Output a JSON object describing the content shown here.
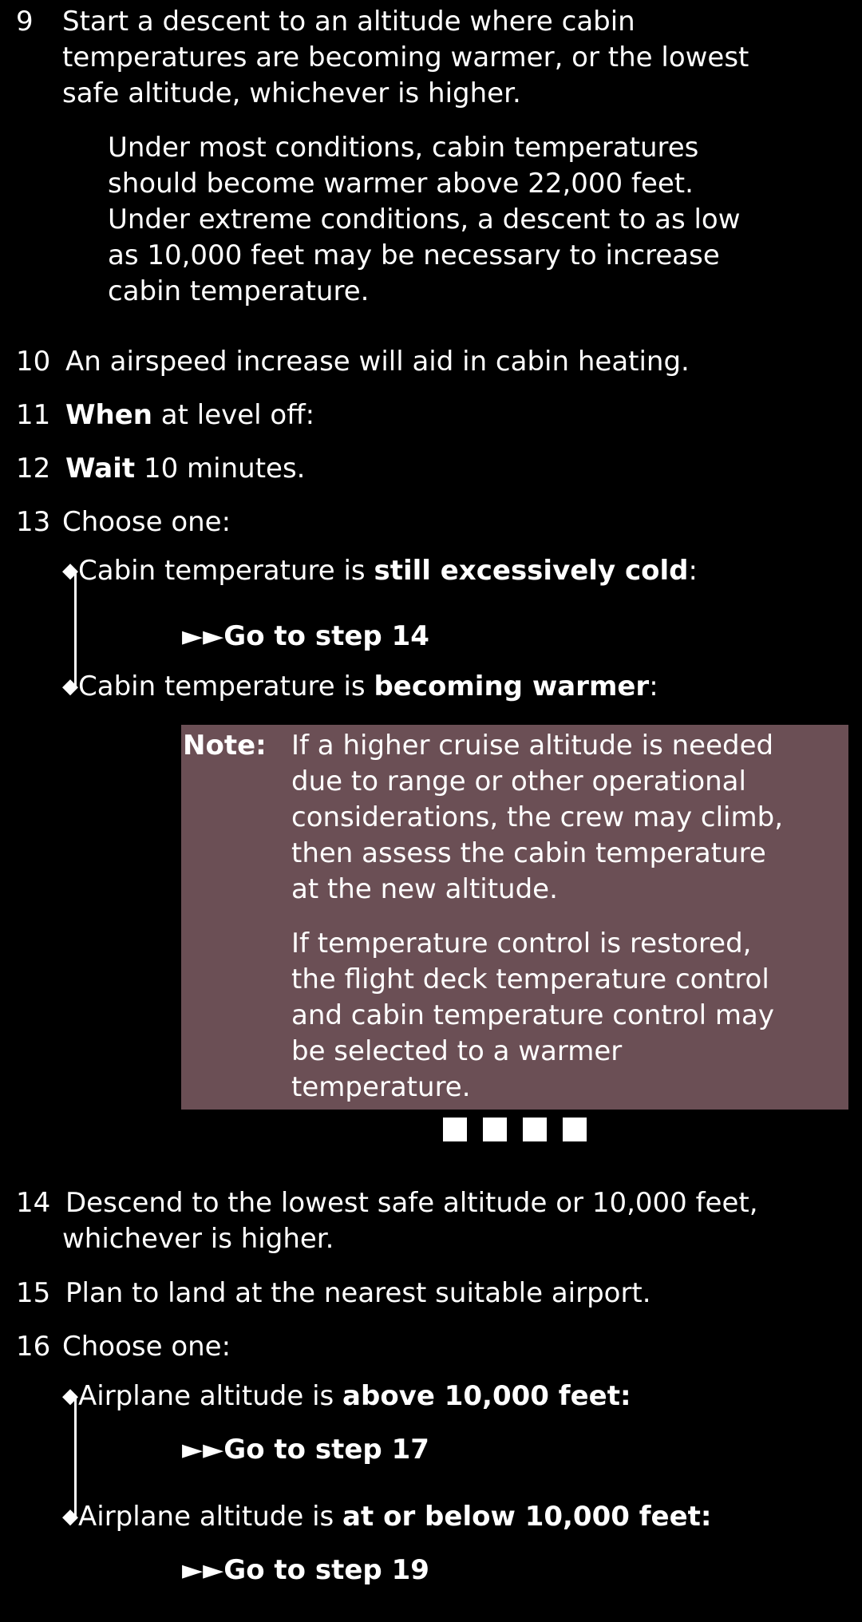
{
  "steps": {
    "s9": {
      "num": "9",
      "line1": "Start a descent to an altitude where cabin",
      "line2": "temperatures are becoming warmer, or the lowest",
      "line3": "safe altitude, whichever is higher.",
      "sub1": "Under most conditions, cabin temperatures",
      "sub2": "should become warmer above 22,000 feet.",
      "sub3": "Under extreme conditions, a descent to as low",
      "sub4": "as 10,000 feet may be necessary to increase",
      "sub5": "cabin temperature."
    },
    "s10": {
      "num": "10",
      "text": "An airspeed increase will aid in cabin heating."
    },
    "s11": {
      "num": "11",
      "bold": "When",
      "rest": " at level off:"
    },
    "s12": {
      "num": "12",
      "bold": "Wait",
      "rest": " 10 minutes."
    },
    "s13": {
      "num": "13",
      "text": "Choose one:",
      "opt1_pre": "Cabin temperature is ",
      "opt1_bold": "still excessively cold",
      "opt1_post": ":",
      "opt1_goto": "Go to step 14",
      "opt2_pre": "Cabin temperature is ",
      "opt2_bold": "becoming warmer",
      "opt2_post": ":",
      "note_label": "Note:",
      "note1_l1": "If a higher cruise altitude is needed",
      "note1_l2": "due to range or other operational",
      "note1_l3": "considerations, the crew may climb,",
      "note1_l4": "then assess the cabin temperature",
      "note1_l5": "at the new altitude.",
      "note2_l1": "If temperature control is restored,",
      "note2_l2": "the flight deck temperature control",
      "note2_l3": "and cabin temperature control may",
      "note2_l4": "be selected to a warmer",
      "note2_l5": "temperature."
    },
    "s14": {
      "num": "14",
      "line1": "Descend to the lowest safe altitude or 10,000 feet,",
      "line2": "whichever is higher."
    },
    "s15": {
      "num": "15",
      "text": "Plan to land at the nearest suitable airport."
    },
    "s16": {
      "num": "16",
      "text": "Choose one:",
      "opt1_pre": "Airplane altitude is ",
      "opt1_bold": "above 10,000 feet:",
      "opt1_goto": "Go to step 17",
      "opt2_pre": "Airplane altitude is ",
      "opt2_bold": "at or below 10,000 feet:",
      "opt2_goto": "Go to step 19"
    }
  },
  "symbols": {
    "goto_arrows": "►►",
    "diamond": "◆"
  },
  "colors": {
    "background": "#000000",
    "text": "#ffffff",
    "note_box": "#6b4f55"
  }
}
